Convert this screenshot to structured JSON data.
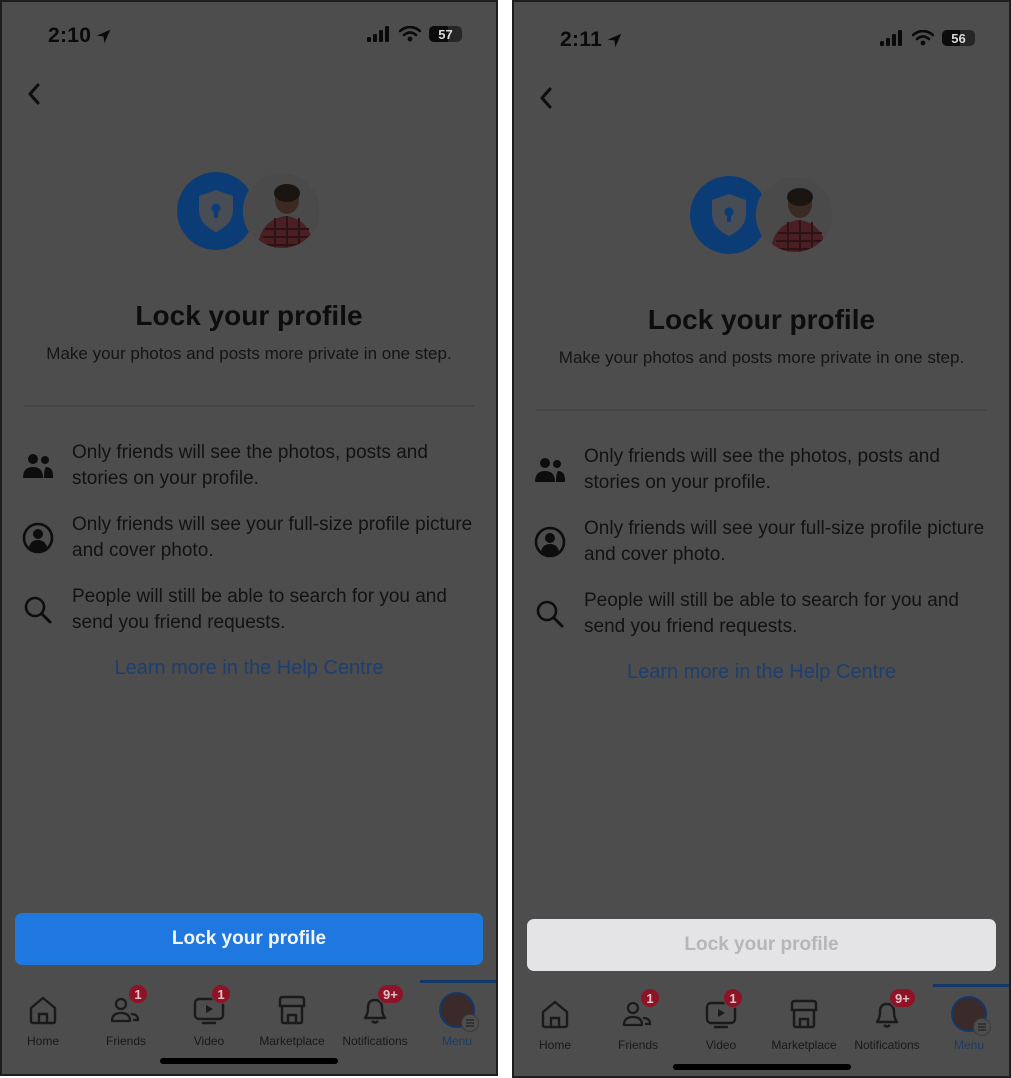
{
  "screens": [
    {
      "status": {
        "time": "2:10",
        "battery": "57",
        "battery_percent": 57
      },
      "back_label": "Back",
      "title": "Lock your profile",
      "subtitle": "Make your photos and posts more private in one step.",
      "features": [
        {
          "icon": "friends-icon",
          "text": "Only friends will see the photos, posts and stories on your profile."
        },
        {
          "icon": "profile-circle-icon",
          "text": "Only friends will see your full-size profile picture and cover photo."
        },
        {
          "icon": "search-icon",
          "text": "People will still be able to search for you and send you friend requests."
        }
      ],
      "help_link": "Learn more in the Help Centre",
      "cta": {
        "label": "Lock your profile",
        "state": "enabled"
      },
      "tabs": [
        {
          "label": "Home",
          "icon": "home-icon",
          "badge": ""
        },
        {
          "label": "Friends",
          "icon": "friends-outline-icon",
          "badge": "1"
        },
        {
          "label": "Video",
          "icon": "video-icon",
          "badge": "1"
        },
        {
          "label": "Marketplace",
          "icon": "marketplace-icon",
          "badge": ""
        },
        {
          "label": "Notifications",
          "icon": "bell-icon",
          "badge": "9+"
        },
        {
          "label": "Menu",
          "icon": "menu-avatar-icon",
          "badge": "",
          "active": true
        }
      ]
    },
    {
      "status": {
        "time": "2:11",
        "battery": "56",
        "battery_percent": 56
      },
      "back_label": "Back",
      "title": "Lock your profile",
      "subtitle": "Make your photos and posts more private in one step.",
      "features": [
        {
          "icon": "friends-icon",
          "text": "Only friends will see the photos, posts and stories on your profile."
        },
        {
          "icon": "profile-circle-icon",
          "text": "Only friends will see your full-size profile picture and cover photo."
        },
        {
          "icon": "search-icon",
          "text": "People will still be able to search for you and send you friend requests."
        }
      ],
      "help_link": "Learn more in the Help Centre",
      "cta": {
        "label": "Lock your profile",
        "state": "disabled"
      },
      "tabs": [
        {
          "label": "Home",
          "icon": "home-icon",
          "badge": ""
        },
        {
          "label": "Friends",
          "icon": "friends-outline-icon",
          "badge": "1"
        },
        {
          "label": "Video",
          "icon": "video-icon",
          "badge": "1"
        },
        {
          "label": "Marketplace",
          "icon": "marketplace-icon",
          "badge": ""
        },
        {
          "label": "Notifications",
          "icon": "bell-icon",
          "badge": "9+"
        },
        {
          "label": "Menu",
          "icon": "menu-avatar-icon",
          "badge": "",
          "active": true
        }
      ]
    }
  ],
  "colors": {
    "overlay_bg": "#4d4d4d",
    "cta_enabled": "#1f77e0",
    "cta_disabled": "#e4e4e7",
    "badge": "#8e1326",
    "shield_circle": "#0c3c75"
  }
}
